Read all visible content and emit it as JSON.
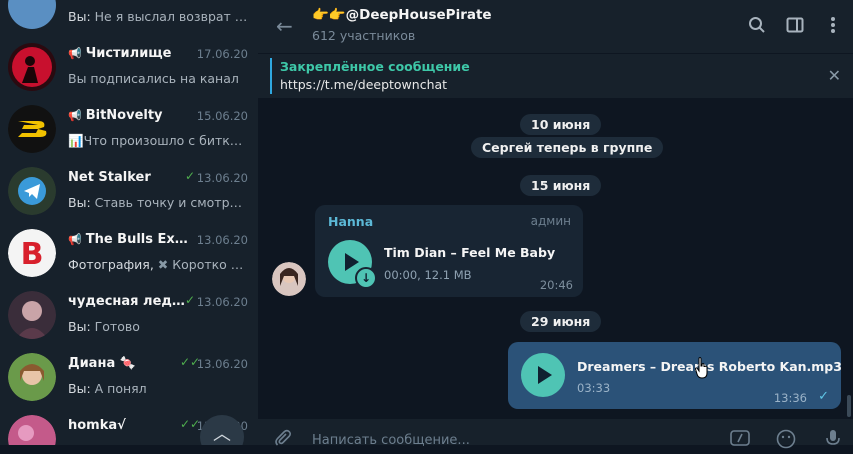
{
  "sidebar": {
    "chats": [
      {
        "name": "",
        "date": "",
        "preview_prefix": "Вы: ",
        "preview": "Не я выслал возврат не т",
        "channel": false,
        "check": ""
      },
      {
        "name": "Чистилище",
        "date": "17.06.20",
        "preview_prefix": "",
        "preview": "Вы подписались на канал",
        "channel": true,
        "check": ""
      },
      {
        "name": "BitNovelty",
        "date": "15.06.20",
        "preview_prefix": "",
        "preview": "Что произошло с битко...",
        "channel": true,
        "check": ""
      },
      {
        "name": "Net Stalker",
        "date": "13.06.20",
        "preview_prefix": "Вы: ",
        "preview": "Ставь точку и смотри Y...",
        "channel": false,
        "check": "✓"
      },
      {
        "name": "The Bulls Exclu...",
        "date": "13.06.20",
        "preview_prefix": "Фотография, ",
        "preview": "Коротко о ...",
        "channel": true,
        "check": ""
      },
      {
        "name": "чудесная леди ...",
        "date": "13.06.20",
        "preview_prefix": "Вы: ",
        "preview": "Готово",
        "channel": false,
        "check": "✓"
      },
      {
        "name": "Диана 🍬",
        "date": "13.06.20",
        "preview_prefix": "Вы: ",
        "preview": "А понял",
        "channel": false,
        "check": "✓✓"
      },
      {
        "name": "homka√",
        "date": "13.06.20",
        "preview_prefix": "",
        "preview": "",
        "channel": false,
        "check": "✓✓"
      }
    ]
  },
  "header": {
    "title": "👉👉@DeepHousePirate",
    "subtitle": "612 участников"
  },
  "pinned": {
    "label": "Закреплённое сообщение",
    "text": "https://t.me/deeptownchat"
  },
  "messages": {
    "date1": "10 июня",
    "service1": "Сергей теперь в группе",
    "date2": "15 июня",
    "msg1": {
      "sender": "Hanna",
      "role": "админ",
      "title": "Tim Dian – Feel Me Baby",
      "meta": "00:00, 12.1 MB",
      "time": "20:46"
    },
    "date3": "29 июня",
    "msg2": {
      "title": "Dreamers – Dreams Roberto Kan.mp3",
      "meta": "03:33",
      "time": "13:36",
      "check": "✓"
    }
  },
  "composer": {
    "placeholder": "Написать сообщение..."
  },
  "colors": {
    "accent": "#4fc4b4",
    "sidebar_bg": "#17212b",
    "chat_bg": "#0e1621",
    "outgoing_bubble": "#2b5278"
  }
}
